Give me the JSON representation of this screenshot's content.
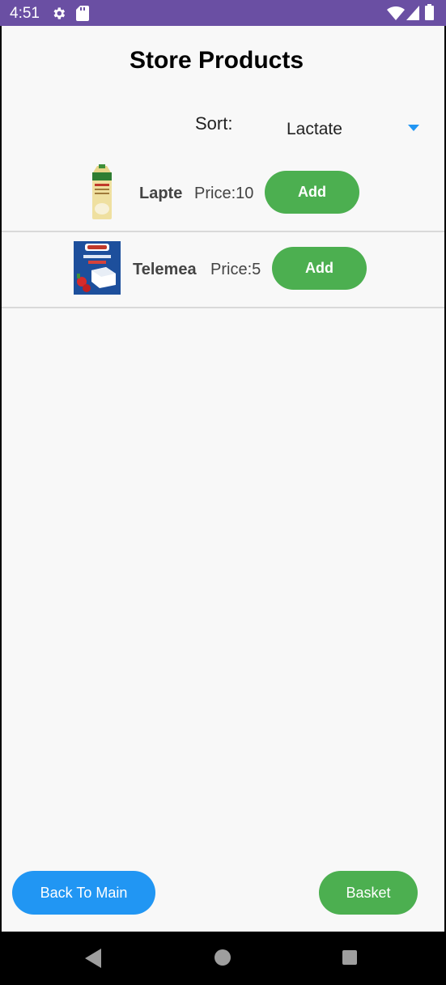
{
  "status_bar": {
    "time": "4:51",
    "left_icons": [
      "gear-icon",
      "sd-card-icon"
    ],
    "right_icons": [
      "wifi-icon",
      "signal-icon",
      "battery-icon"
    ],
    "color": "#6a4fa3"
  },
  "header": {
    "title": "Store Products"
  },
  "sort": {
    "label": "Sort:",
    "selected": "Lactate"
  },
  "products": [
    {
      "name": "Lapte",
      "price": "Price:10",
      "add_label": "Add",
      "image": "milk-carton-image"
    },
    {
      "name": "Telemea",
      "price": "Price:5",
      "add_label": "Add",
      "image": "cheese-package-image"
    }
  ],
  "footer": {
    "back_label": "Back To Main",
    "basket_label": "Basket"
  },
  "nav": [
    "back-icon",
    "home-icon",
    "recents-icon"
  ],
  "colors": {
    "accent_green": "#4caf50",
    "accent_blue": "#2196f3",
    "spinner_arrow": "#2196f3"
  }
}
